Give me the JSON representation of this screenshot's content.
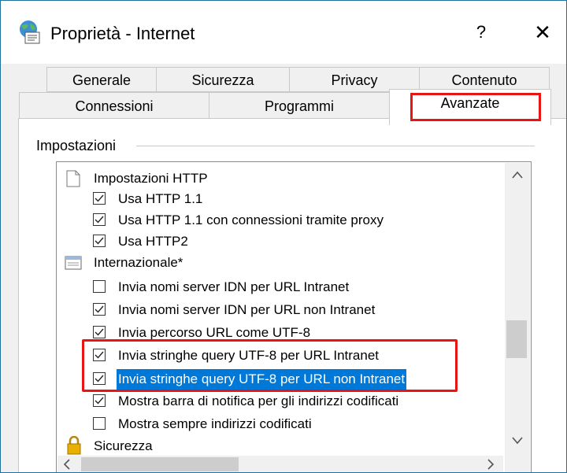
{
  "window": {
    "title": "Proprietà - Internet",
    "help_label": "?",
    "close_label": "✕"
  },
  "tabs": {
    "row1": [
      "Generale",
      "Sicurezza",
      "Privacy",
      "Contenuto"
    ],
    "row2": [
      "Connessioni",
      "Programmi",
      "Avanzate"
    ],
    "active": "Avanzate"
  },
  "settings": {
    "group_label": "Impostazioni",
    "items": [
      {
        "type": "category",
        "icon": "page-icon",
        "label": "Impostazioni HTTP"
      },
      {
        "type": "checkbox",
        "checked": true,
        "label": "Usa HTTP 1.1"
      },
      {
        "type": "checkbox",
        "checked": true,
        "label": "Usa HTTP 1.1 con connessioni tramite proxy"
      },
      {
        "type": "checkbox",
        "checked": true,
        "label": "Usa HTTP2"
      },
      {
        "type": "category",
        "icon": "window-icon",
        "label": "Internazionale*"
      },
      {
        "type": "checkbox",
        "checked": false,
        "label": "Invia nomi server IDN per URL Intranet"
      },
      {
        "type": "checkbox",
        "checked": true,
        "label": "Invia nomi server IDN per URL non Intranet"
      },
      {
        "type": "checkbox",
        "checked": true,
        "label": "Invia percorso URL come UTF-8"
      },
      {
        "type": "checkbox",
        "checked": true,
        "label": "Invia stringhe query UTF-8 per URL Intranet"
      },
      {
        "type": "checkbox",
        "checked": true,
        "selected": true,
        "label": "Invia stringhe query UTF-8 per URL non Intranet"
      },
      {
        "type": "checkbox",
        "checked": true,
        "label": "Mostra barra di notifica per gli indirizzi codificati"
      },
      {
        "type": "checkbox",
        "checked": false,
        "label": "Mostra sempre indirizzi codificati"
      },
      {
        "type": "category",
        "icon": "lock-icon",
        "label": "Sicurezza"
      }
    ]
  },
  "colors": {
    "highlight_red": "#e81515",
    "selection_blue": "#0078d7"
  }
}
